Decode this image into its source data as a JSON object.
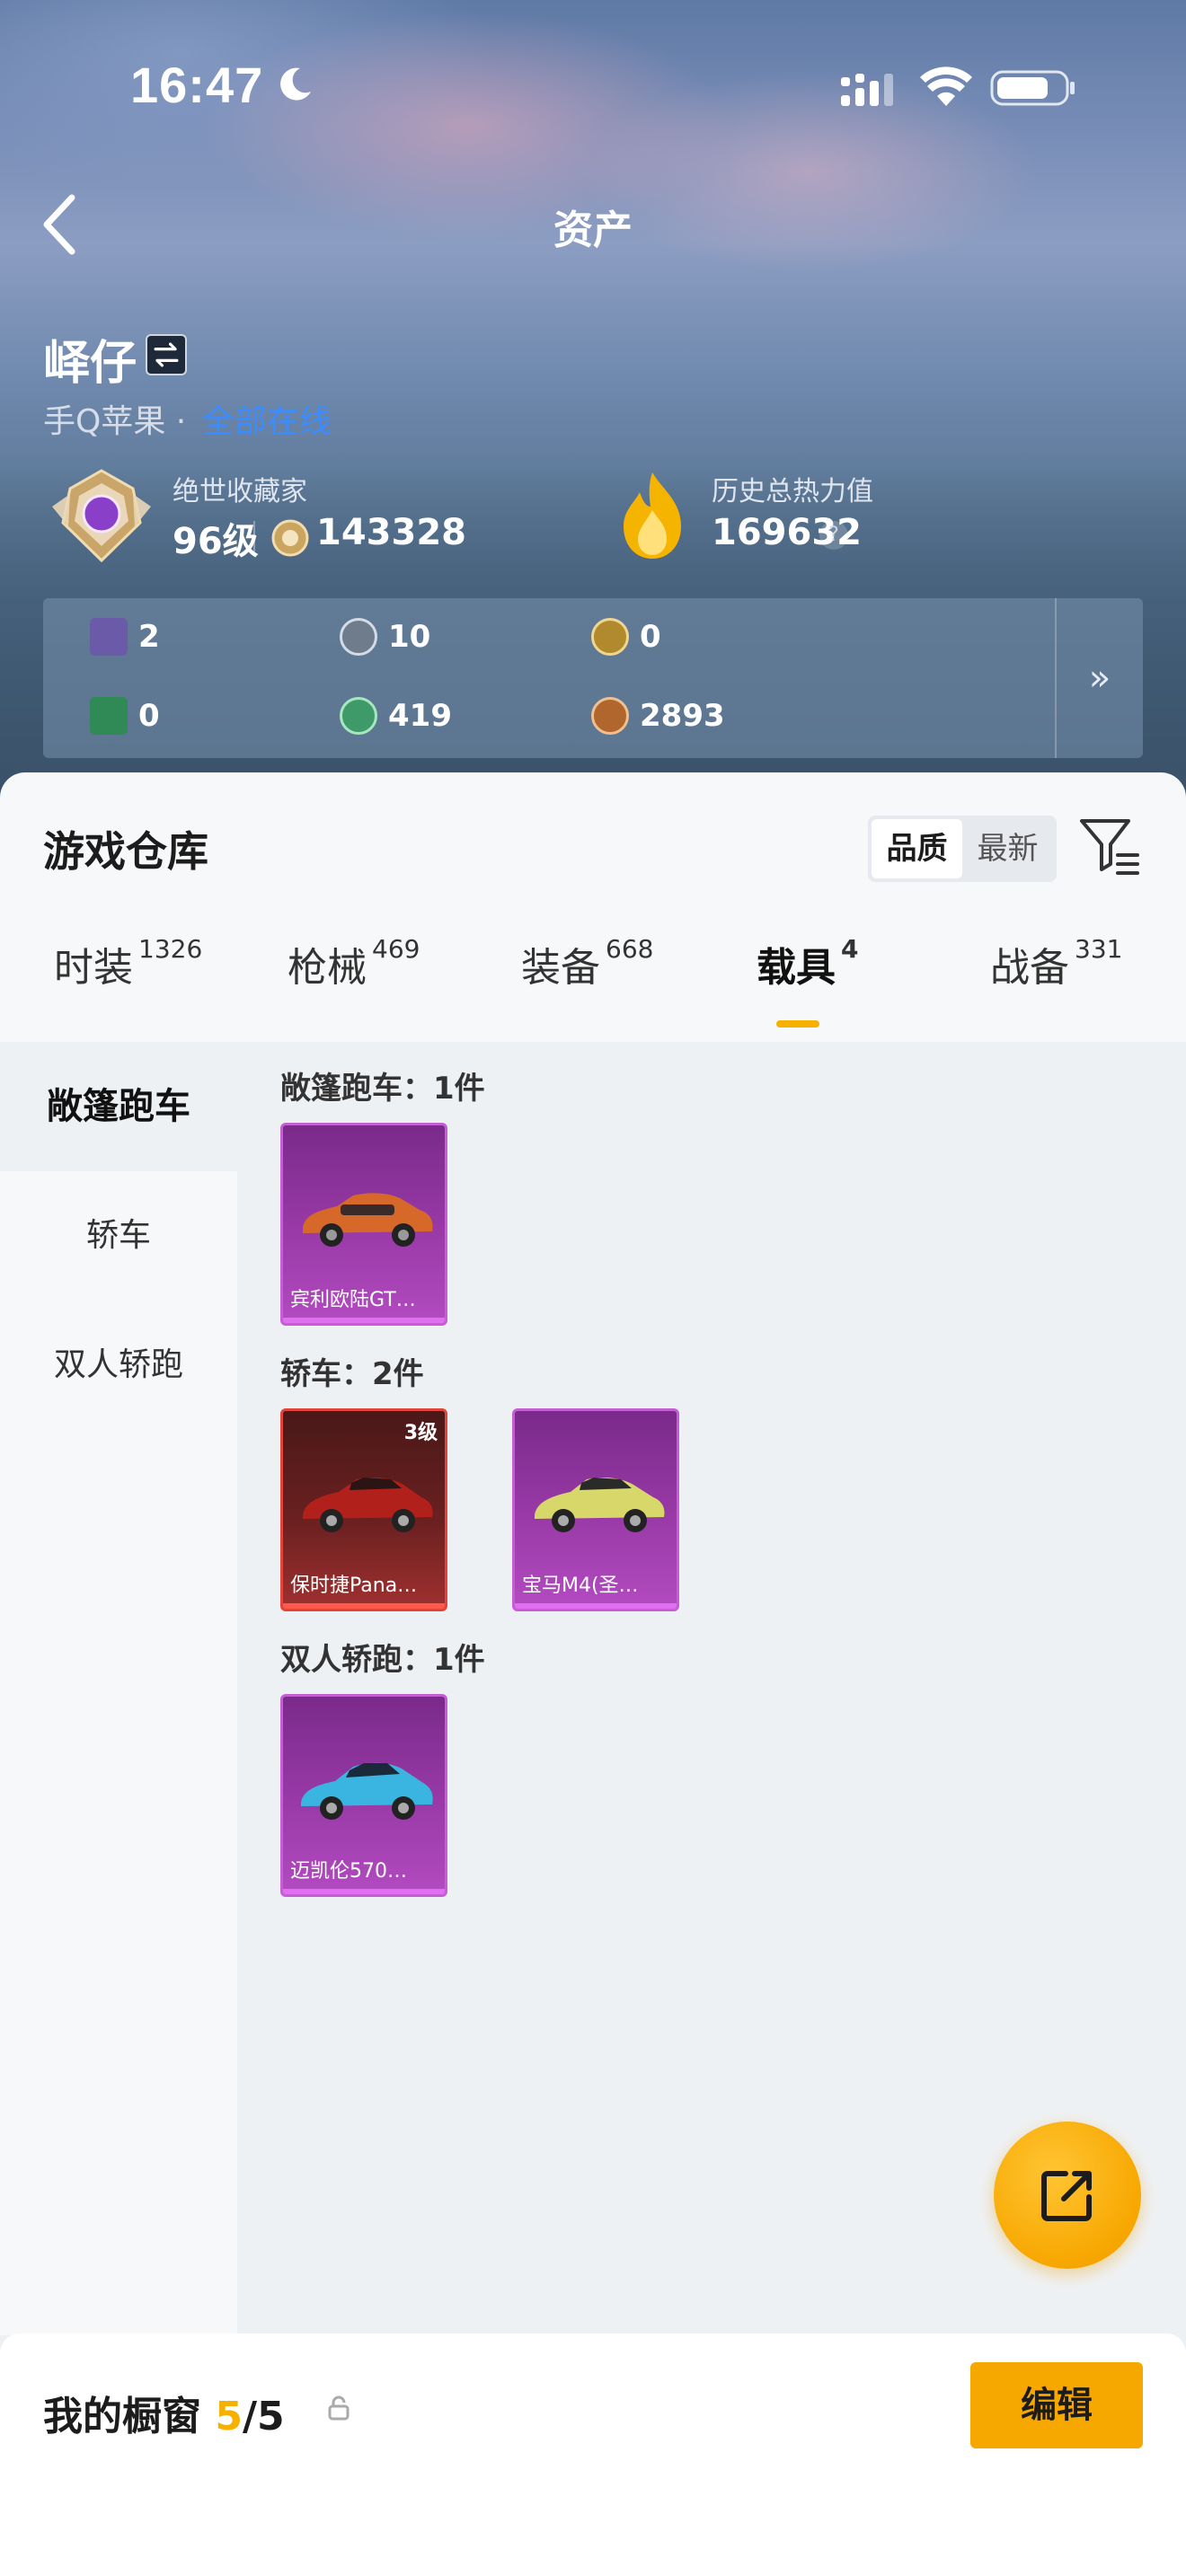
{
  "status_bar": {
    "time": "16:47"
  },
  "nav": {
    "title": "资产"
  },
  "profile": {
    "username": "峄仔",
    "platform": "手Q苹果",
    "separator": "·",
    "online_status": "全部在线",
    "rank_title": "绝世收藏家",
    "rank_level": "96级",
    "coin_value": "143328",
    "heat_title": "历史总热力值",
    "heat_value": "169632",
    "help_symbol": "?"
  },
  "currencies": [
    {
      "icon": "purple-card-icon",
      "value": "2",
      "color": "#6b5aa8"
    },
    {
      "icon": "silver-coin-icon",
      "value": "10",
      "color": "#6f7c8c"
    },
    {
      "icon": "gold-triangle-coin-icon",
      "value": "0",
      "color": "#b08a2c"
    },
    {
      "icon": "green-card-icon",
      "value": "0",
      "color": "#2f8a55"
    },
    {
      "icon": "green-gem-icon",
      "value": "419",
      "color": "#3f9a6a"
    },
    {
      "icon": "bronze-coin-icon",
      "value": "2893",
      "color": "#b0662c"
    }
  ],
  "currency_more": "»",
  "warehouse": {
    "title": "游戏仓库",
    "sort_quality": "品质",
    "sort_latest": "最新"
  },
  "tabs": [
    {
      "label": "时装",
      "count": "1326"
    },
    {
      "label": "枪械",
      "count": "469"
    },
    {
      "label": "装备",
      "count": "668"
    },
    {
      "label": "载具",
      "count": "4",
      "active": true
    },
    {
      "label": "战备",
      "count": "331"
    }
  ],
  "sidebar": {
    "items": [
      {
        "label": "敞篷跑车",
        "active": true
      },
      {
        "label": "轿车"
      },
      {
        "label": "双人轿跑"
      }
    ]
  },
  "groups": [
    {
      "title": "敞篷跑车：1件",
      "items": [
        {
          "name": "宾利欧陆GT…",
          "car_color": "#d6682a",
          "level": ""
        }
      ]
    },
    {
      "title": "轿车：2件",
      "items": [
        {
          "name": "保时捷Pana…",
          "car_color": "#b2201c",
          "level": "3级"
        },
        {
          "name": "宝马M4(圣…",
          "car_color": "#d8d86a",
          "level": ""
        }
      ]
    },
    {
      "title": "双人轿跑：1件",
      "items": [
        {
          "name": "迈凯伦570…",
          "car_color": "#3ab4e0",
          "level": ""
        }
      ]
    }
  ],
  "showcase": {
    "title": "我的橱窗",
    "count": "5",
    "total": "/5",
    "edit_label": "编辑"
  },
  "colors": {
    "accent": "#f5b000",
    "link": "#3b8cff",
    "legendary_purple": "#b24bc0",
    "legendary_red": "#e0443a"
  }
}
